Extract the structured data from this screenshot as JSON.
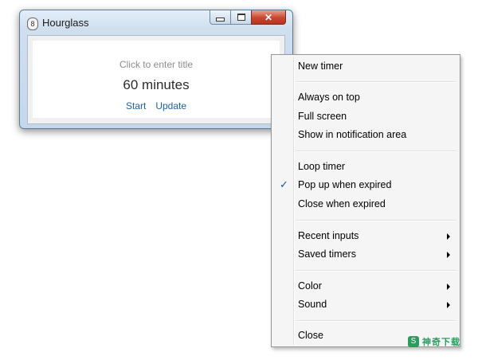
{
  "window": {
    "title": "Hourglass",
    "app_icon": "8",
    "controls": {
      "close_glyph": "✕"
    }
  },
  "timer": {
    "title_placeholder": "Click to enter title",
    "value": "60 minutes",
    "start_label": "Start",
    "update_label": "Update"
  },
  "menu": {
    "new_timer": "New timer",
    "always_on_top": "Always on top",
    "full_screen": "Full screen",
    "show_in_notification_area": "Show in notification area",
    "loop_timer": "Loop timer",
    "pop_up_when_expired": "Pop up when expired",
    "pop_up_checked": true,
    "close_when_expired": "Close when expired",
    "recent_inputs": "Recent inputs",
    "saved_timers": "Saved timers",
    "color": "Color",
    "sound": "Sound",
    "close": "Close",
    "check_mark": "✓"
  },
  "watermark": {
    "icon": "S",
    "text": "神奇下载"
  },
  "colors": {
    "link": "#1e5fa8",
    "close_button": "#c9462e",
    "watermark": "#2f9a5f"
  }
}
